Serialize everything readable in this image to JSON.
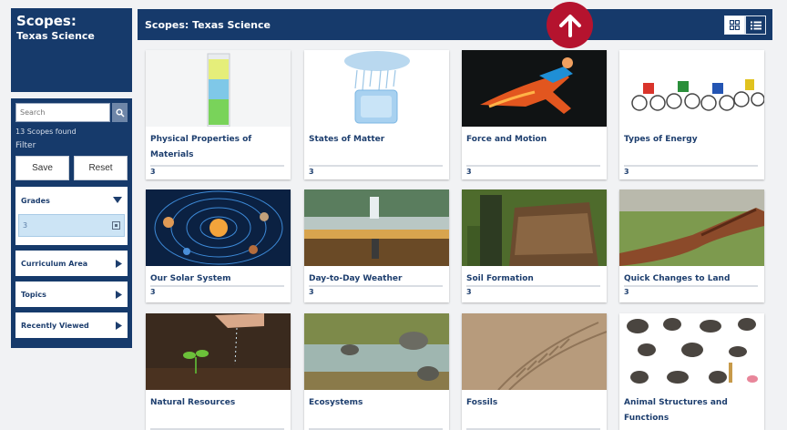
{
  "header": {
    "title_line1": "Scopes:",
    "title_line2": "Texas Science",
    "bar_title": "Scopes: Texas Science"
  },
  "sidebar": {
    "search_placeholder": "Search",
    "found_text": "13 Scopes found",
    "filter_label": "Filter",
    "save_label": "Save",
    "reset_label": "Reset",
    "grades_label": "Grades",
    "selected_grade": "3",
    "facets": [
      "Curriculum Area",
      "Topics",
      "Recently Viewed"
    ]
  },
  "icons": {
    "search": "search-icon",
    "grid": "grid-view-icon",
    "list": "list-view-icon",
    "up": "arrow-up-icon",
    "expand": "caret-down-icon",
    "collapse": "caret-right-icon",
    "remove": "close-box-icon"
  },
  "colors": {
    "navy": "#163a6b",
    "accent_red": "#b5132e",
    "title_blue": "#1d3e6e",
    "grade_bg": "#cce4f5"
  },
  "cards": [
    {
      "title": "Physical Properties of Materials",
      "count": "3"
    },
    {
      "title": "States of Matter",
      "count": "3"
    },
    {
      "title": "Force and Motion",
      "count": "3"
    },
    {
      "title": "Types of Energy",
      "count": "3"
    },
    {
      "title": "Our Solar System",
      "count": "3"
    },
    {
      "title": "Day-to-Day Weather",
      "count": "3"
    },
    {
      "title": "Soil Formation",
      "count": "3"
    },
    {
      "title": "Quick Changes to Land",
      "count": "3"
    },
    {
      "title": "Natural Resources",
      "count": ""
    },
    {
      "title": "Ecosystems",
      "count": ""
    },
    {
      "title": "Fossils",
      "count": ""
    },
    {
      "title": "Animal Structures and Functions",
      "count": ""
    }
  ]
}
